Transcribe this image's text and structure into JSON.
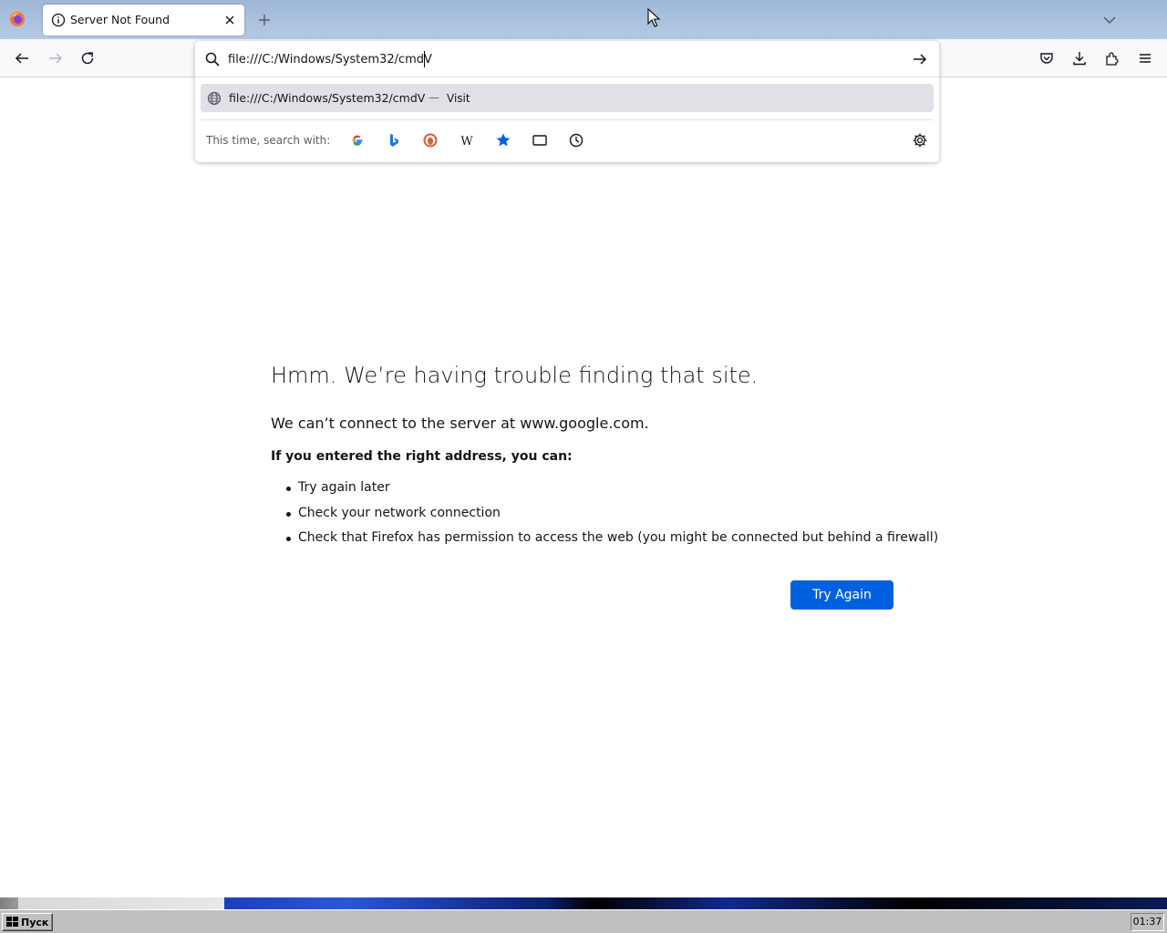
{
  "tab": {
    "title": "Server Not Found"
  },
  "urlbar": {
    "input_value": "file:///C:/Windows/System32/cmdV",
    "suggestion": {
      "url": "file:///C:/Windows/System32/cmdV",
      "separator": "—",
      "action": "Visit"
    },
    "oneoff_label": "This time, search with:",
    "engines": [
      "google-icon",
      "bing-icon",
      "duckduckgo-icon",
      "wikipedia-icon",
      "bookmarks-icon",
      "tabs-icon",
      "history-icon"
    ]
  },
  "error_page": {
    "title": "Hmm. We’re having trouble finding that site.",
    "description": "We can’t connect to the server at www.google.com.",
    "hint": "If you entered the right address, you can:",
    "suggestions": [
      "Try again later",
      "Check your network connection",
      "Check that Firefox has permission to access the web (you might be connected but behind a firewall)"
    ],
    "try_again_label": "Try Again"
  },
  "taskbar": {
    "start_label": "Пуск",
    "clock": "01:37"
  },
  "colors": {
    "accent": "#0061e0",
    "tabstrip": "#a6bfdc",
    "toolbar": "#f9f9fb",
    "taskbar": "#c0c0c0"
  }
}
